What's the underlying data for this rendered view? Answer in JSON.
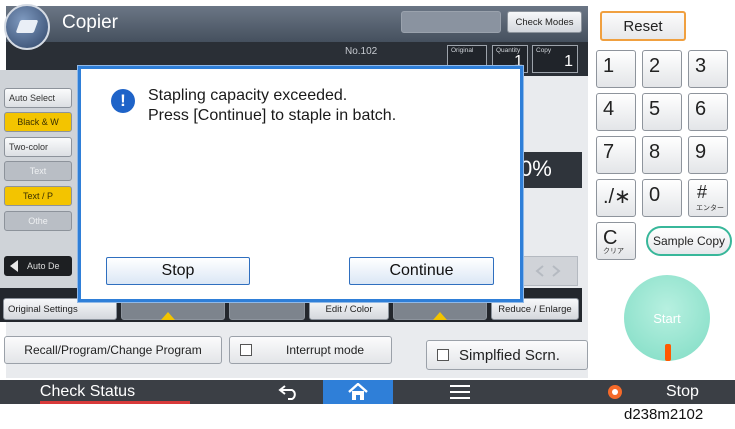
{
  "app": {
    "title": "Copier",
    "number": "No.102"
  },
  "toolbar": {
    "check_modes": "Check Modes"
  },
  "counters": {
    "original_label": "Original",
    "original_value": "",
    "quantity_label": "Quantity",
    "quantity_value": "1",
    "copy_label": "Copy",
    "copy_value": "1"
  },
  "left_panel": {
    "auto_select": "Auto Select",
    "black": "Black & W",
    "two_color": "Two-color",
    "text": "Text",
    "text_photo": "Text / P",
    "other": "Othe",
    "auto_density": "Auto De"
  },
  "main": {
    "ratio": "0%"
  },
  "tabs": {
    "original_settings": "Original Settings",
    "edit_color": "Edit / Color",
    "reduce_enlarge": "Reduce / Enlarge"
  },
  "bottom_buttons": {
    "recall": "Recall/Program/Change Program",
    "interrupt": "Interrupt mode",
    "simplified": "Simplfied Scrn."
  },
  "dialog": {
    "message_line1": "Stapling capacity exceeded.",
    "message_line2": "Press [Continue] to staple in batch.",
    "stop_label": "Stop",
    "continue_label": "Continue"
  },
  "keypad": {
    "reset": "Reset",
    "keys": [
      "1",
      "2",
      "3",
      "4",
      "5",
      "6",
      "7",
      "8",
      "9",
      "./∗",
      "0",
      "#"
    ],
    "hash_sub": "エンター",
    "clear": "C",
    "clear_sub": "クリア",
    "sample_copy": "Sample Copy",
    "start": "Start"
  },
  "sysbar": {
    "check_status": "Check Status",
    "stop": "Stop",
    "active_tab": "home"
  },
  "caption": "d238m2102",
  "colors": {
    "dialog_border": "#2f7fd8",
    "highlight_yellow": "#f3c400",
    "start_button": "#7fdcc4",
    "reset_border": "#f0a040",
    "home_tab": "#2f7fd8"
  }
}
